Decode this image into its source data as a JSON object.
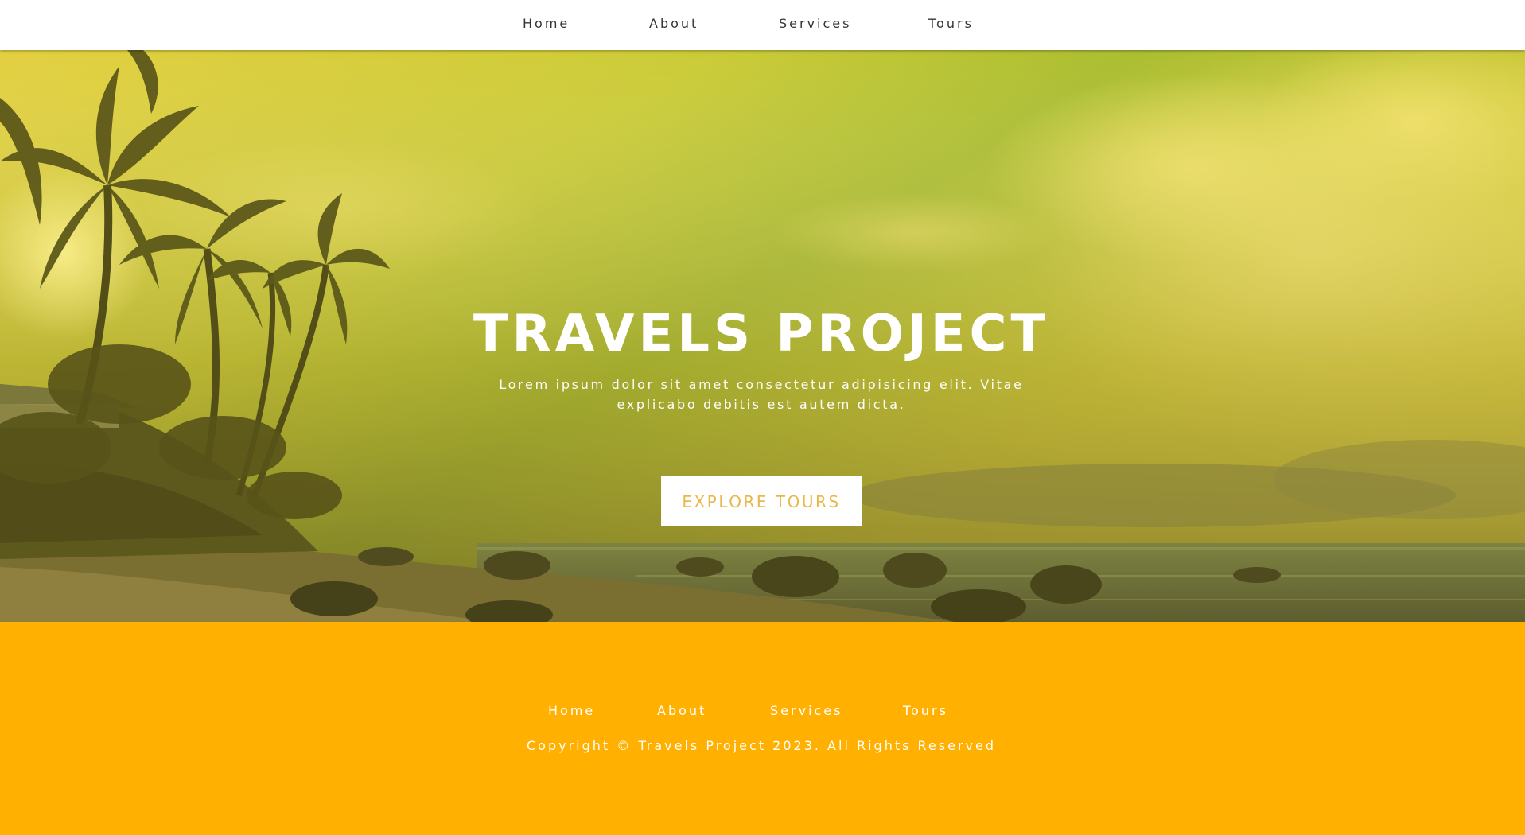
{
  "nav": {
    "items": [
      {
        "label": "Home"
      },
      {
        "label": "About"
      },
      {
        "label": "Services"
      },
      {
        "label": "Tours"
      }
    ]
  },
  "hero": {
    "title": "TRAVELS PROJECT",
    "text": "Lorem ipsum dolor sit amet consectetur adipisicing elit. Vitae explicabo debitis est autem dicta.",
    "button_label": "EXPLORE TOURS",
    "background": "tropical-beach-photo"
  },
  "footer": {
    "items": [
      {
        "label": "Home"
      },
      {
        "label": "About"
      },
      {
        "label": "Services"
      },
      {
        "label": "Tours"
      }
    ],
    "copyright": "Copyright © Travels Project 2023. All Rights Reserved"
  },
  "colors": {
    "accent": "#ffb000",
    "button_text": "#e8b84a",
    "nav_bg": "#ffffff"
  }
}
